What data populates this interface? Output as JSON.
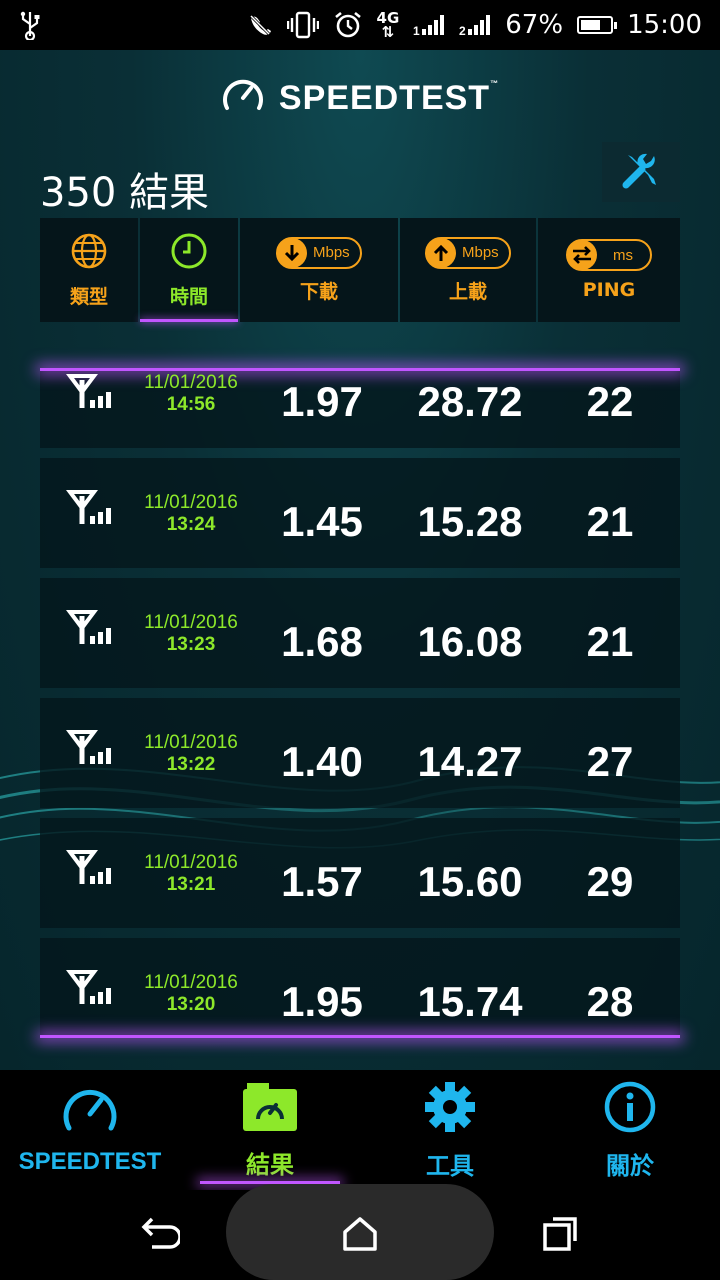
{
  "status_bar": {
    "network": "4G",
    "battery_percent": "67%",
    "battery_level": 0.67,
    "time": "15:00",
    "icons": [
      "usb-icon",
      "mute-icon",
      "vibrate-icon",
      "alarm-icon",
      "network-4g-icon",
      "signal-1-icon",
      "signal-2-icon",
      "battery-charging-icon"
    ]
  },
  "app": {
    "brand": "SPEEDTEST",
    "trademark": "™",
    "results_title": "350 結果",
    "tools_icon": "wrench-screwdriver-icon"
  },
  "header": {
    "type_label": "類型",
    "time_label": "時間",
    "download_label": "下載",
    "download_unit": "Mbps",
    "upload_label": "上載",
    "upload_unit": "Mbps",
    "ping_label": "PING",
    "ping_unit": "ms",
    "active": "time",
    "colors": {
      "accent": "#f6a21a",
      "active": "#8de82a",
      "highlight": "#c156ff"
    }
  },
  "results": [
    {
      "type_icon": "cellular-icon",
      "date": "11/01/2016",
      "time": "14:56",
      "download": "1.97",
      "upload": "28.72",
      "ping": "22"
    },
    {
      "type_icon": "cellular-icon",
      "date": "11/01/2016",
      "time": "13:24",
      "download": "1.45",
      "upload": "15.28",
      "ping": "21"
    },
    {
      "type_icon": "cellular-icon",
      "date": "11/01/2016",
      "time": "13:23",
      "download": "1.68",
      "upload": "16.08",
      "ping": "21"
    },
    {
      "type_icon": "cellular-icon",
      "date": "11/01/2016",
      "time": "13:22",
      "download": "1.40",
      "upload": "14.27",
      "ping": "27"
    },
    {
      "type_icon": "cellular-icon",
      "date": "11/01/2016",
      "time": "13:21",
      "download": "1.57",
      "upload": "15.60",
      "ping": "29"
    },
    {
      "type_icon": "cellular-icon",
      "date": "11/01/2016",
      "time": "13:20",
      "download": "1.95",
      "upload": "15.74",
      "ping": "28"
    }
  ],
  "bottom_nav": {
    "items": [
      {
        "label": "SPEEDTEST",
        "icon": "speedometer-icon"
      },
      {
        "label": "結果",
        "icon": "results-folder-icon",
        "active": true
      },
      {
        "label": "工具",
        "icon": "gear-icon"
      },
      {
        "label": "關於",
        "icon": "info-icon"
      }
    ]
  },
  "system_nav": {
    "icons": [
      "back-icon",
      "home-icon",
      "recents-icon"
    ]
  }
}
